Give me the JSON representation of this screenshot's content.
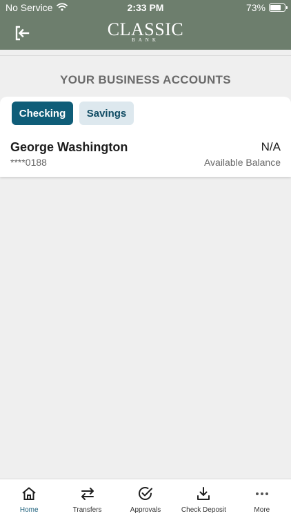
{
  "status_bar": {
    "carrier": "No Service",
    "time": "2:33 PM",
    "battery": "73%"
  },
  "header": {
    "logo_main": "CLASSIC",
    "logo_sub": "BANK"
  },
  "page": {
    "title": "YOUR BUSINESS ACCOUNTS"
  },
  "tabs": [
    {
      "label": "Checking",
      "active": true
    },
    {
      "label": "Savings",
      "active": false
    }
  ],
  "account": {
    "name": "George Washington",
    "number": "****0188",
    "balance": "N/A",
    "balance_label": "Available Balance"
  },
  "nav": [
    {
      "label": "Home",
      "icon": "home-icon"
    },
    {
      "label": "Transfers",
      "icon": "transfer-icon"
    },
    {
      "label": "Approvals",
      "icon": "check-circle-icon"
    },
    {
      "label": "Check Deposit",
      "icon": "download-icon"
    },
    {
      "label": "More",
      "icon": "more-icon"
    }
  ],
  "colors": {
    "header": "#6d7e6d",
    "accent": "#0f5d78",
    "background": "#efefef"
  }
}
